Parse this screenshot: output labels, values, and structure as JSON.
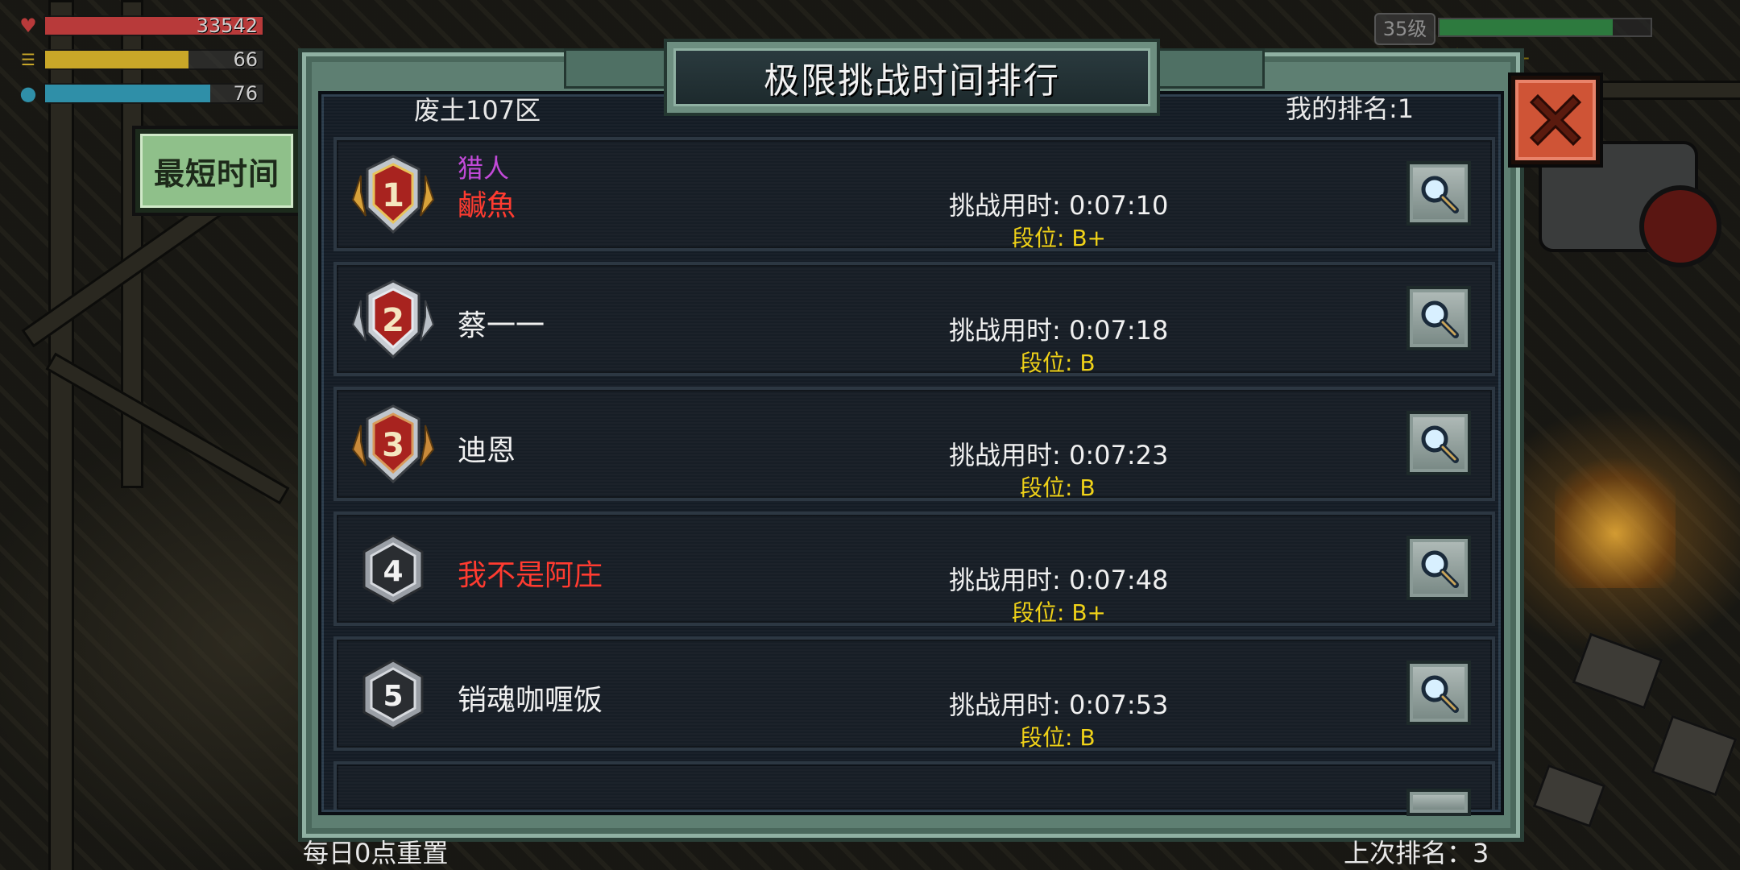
{
  "hud": {
    "hp": {
      "icon": "heart-icon",
      "value": "33542",
      "fill": 1.0,
      "color": "#b83a3a"
    },
    "food": {
      "icon": "burger-icon",
      "value": "66",
      "fill": 0.66,
      "color": "#c9a728"
    },
    "water": {
      "icon": "water-drop-icon",
      "value": "76",
      "fill": 0.76,
      "color": "#2f8fa8"
    },
    "level": "35级",
    "xp_fill": 0.82,
    "rank_hint": "段位: B+"
  },
  "side_tab": {
    "label": "最短时间"
  },
  "panel": {
    "title": "极限挑战时间排行",
    "zone": "废土107区",
    "my_rank": "我的排名:1",
    "footer_left": "每日0点重置",
    "footer_right": "上次排名：3"
  },
  "rows": [
    {
      "rank": "1",
      "medal": "gold-medal-icon",
      "title": "猎人",
      "name": "鹹魚",
      "name_color": "#ff3b30",
      "time": "挑战用时: 0:07:10",
      "grade": "段位: B+"
    },
    {
      "rank": "2",
      "medal": "silver-medal-icon",
      "title": "",
      "name": "蔡一一",
      "name_color": "#f0f0f0",
      "time": "挑战用时: 0:07:18",
      "grade": "段位: B"
    },
    {
      "rank": "3",
      "medal": "bronze-medal-icon",
      "title": "",
      "name": "迪恩",
      "name_color": "#f0f0f0",
      "time": "挑战用时: 0:07:23",
      "grade": "段位: B"
    },
    {
      "rank": "4",
      "medal": "hex-rank-icon",
      "title": "",
      "name": "我不是阿庄",
      "name_color": "#ff3b30",
      "time": "挑战用时: 0:07:48",
      "grade": "段位: B+"
    },
    {
      "rank": "5",
      "medal": "hex-rank-icon",
      "title": "",
      "name": "销魂咖喱饭",
      "name_color": "#f0f0f0",
      "time": "挑战用时: 0:07:53",
      "grade": "段位: B"
    }
  ]
}
